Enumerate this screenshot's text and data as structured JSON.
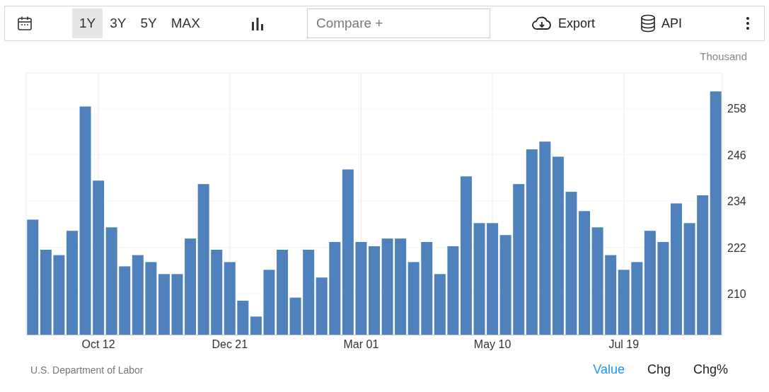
{
  "toolbar": {
    "ranges": [
      {
        "label": "1Y",
        "selected": true
      },
      {
        "label": "3Y",
        "selected": false
      },
      {
        "label": "5Y",
        "selected": false
      },
      {
        "label": "MAX",
        "selected": false
      }
    ],
    "compare": {
      "placeholder": "Compare +"
    },
    "export": "Export",
    "api": "API"
  },
  "chart": {
    "chart_data": {
      "type": "bar",
      "ylabel": "Thousand",
      "categories": [
        null,
        null,
        null,
        null,
        null,
        "Oct 12",
        null,
        null,
        null,
        null,
        null,
        null,
        null,
        null,
        null,
        "Dec 21",
        null,
        null,
        null,
        null,
        null,
        null,
        null,
        null,
        null,
        "Mar 01",
        null,
        null,
        null,
        null,
        null,
        null,
        null,
        null,
        null,
        "May 10",
        null,
        null,
        null,
        null,
        null,
        null,
        null,
        null,
        null,
        "Jul 19",
        null,
        null,
        null,
        null,
        null,
        null,
        null
      ],
      "series": [
        {
          "color": "#4f81bd",
          "values": [
            229.2,
            221.4,
            220,
            226.3,
            258.5,
            239.3,
            227.2,
            217.1,
            220,
            218.2,
            215.1,
            215.1,
            224.3,
            238.4,
            221.4,
            218.2,
            208.2,
            204.1,
            216.2,
            221.4,
            209,
            221.4,
            214.2,
            223.4,
            242.2,
            223.4,
            222.3,
            224.3,
            224.3,
            218.2,
            223.4,
            215.1,
            222.3,
            240.4,
            228.3,
            228.3,
            225.2,
            238.4,
            247.4,
            249.4,
            245.5,
            236.4,
            231.4,
            227.2,
            220,
            216.2,
            218.2,
            226.3,
            223.4,
            233.4,
            228.3,
            235.5,
            262.4
          ]
        }
      ],
      "grid": true,
      "ylim": [
        199.4,
        267.2
      ],
      "yticks": [
        210,
        222,
        234,
        246,
        258
      ]
    }
  },
  "footer": {
    "source": "U.S. Department of Labor",
    "views": [
      {
        "label": "Value",
        "selected": true
      },
      {
        "label": "Chg",
        "selected": false
      },
      {
        "label": "Chg%",
        "selected": false
      }
    ]
  }
}
